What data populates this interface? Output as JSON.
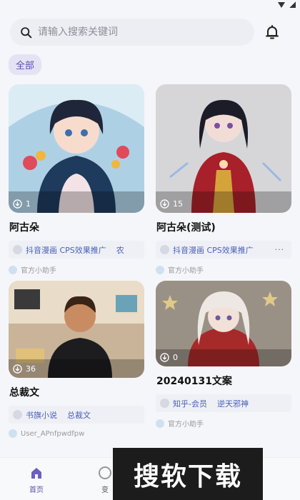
{
  "search": {
    "placeholder": "请输入搜索关键词"
  },
  "filters": {
    "active": "全部"
  },
  "cards": [
    {
      "title": "阿古朵",
      "downloads": "1",
      "tags": [
        "抖音漫画 CPS效果推广",
        "农"
      ],
      "author": "官方小助手"
    },
    {
      "title": "阿古朵(测试)",
      "downloads": "15",
      "tags": [
        "抖音漫画 CPS效果推广"
      ],
      "more": "···",
      "author": "官方小助手"
    },
    {
      "title": "总裁文",
      "downloads": "36",
      "tags": [
        "书旗小说",
        "总裁文"
      ],
      "author": "User_APnfpwdfpw"
    },
    {
      "title": "20240131文案",
      "downloads": "0",
      "tags": [
        "知乎-会员",
        "逆天邪神"
      ],
      "author": "官方小助手"
    }
  ],
  "nav": {
    "home": "首页",
    "second": "变"
  },
  "watermark": "搜软下载",
  "colors": {
    "accent": "#5a4fb0",
    "tag_text": "#4a5fb8"
  }
}
